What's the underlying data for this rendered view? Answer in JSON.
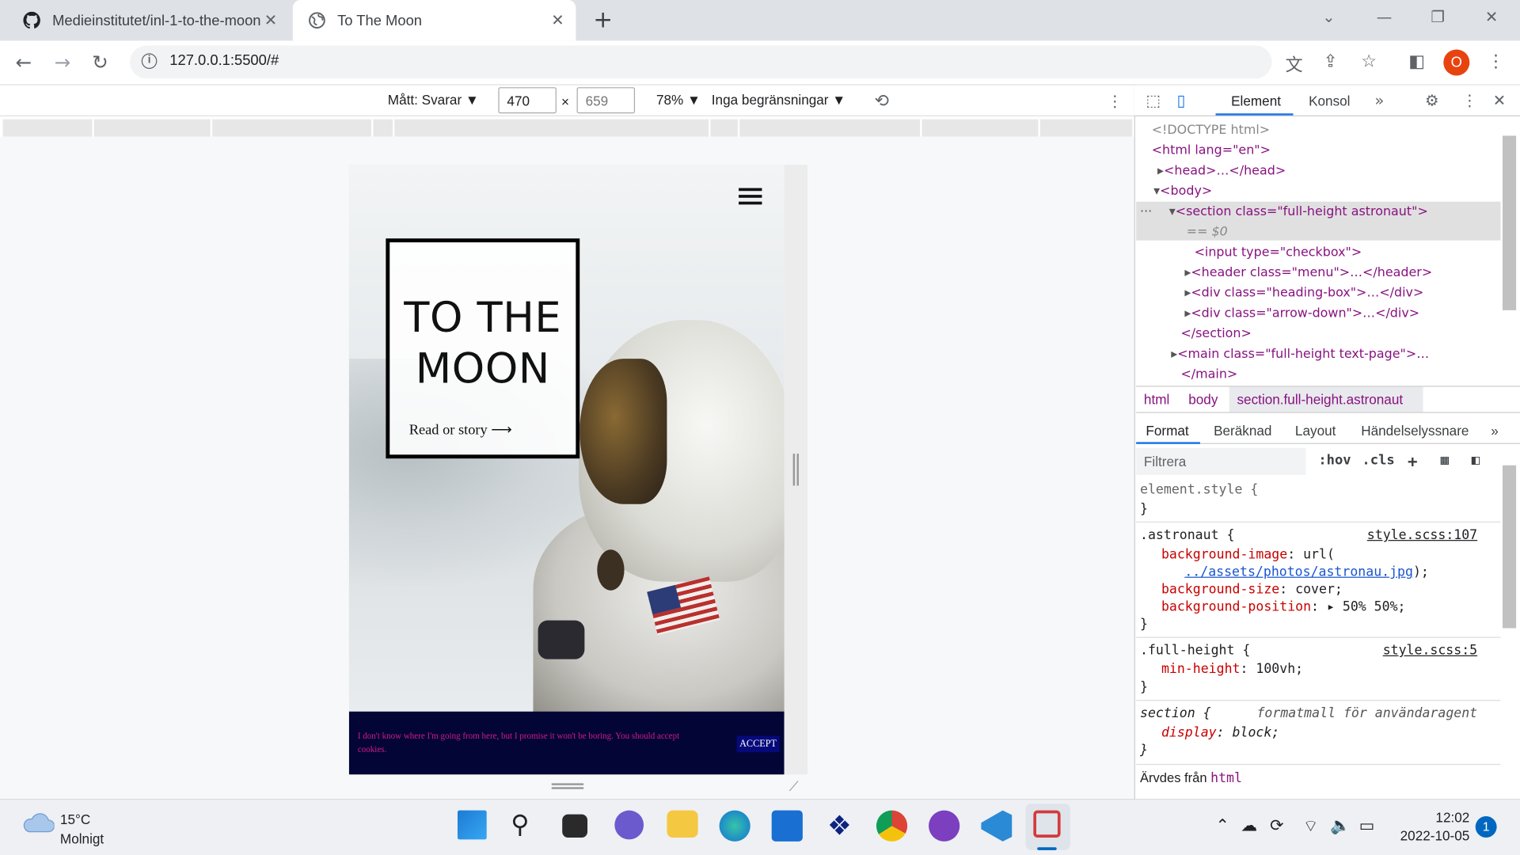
{
  "browser": {
    "tabs": [
      {
        "title": "Medieinstitutet/inl-1-to-the-moon",
        "icon": "github-icon"
      },
      {
        "title": "To The Moon",
        "icon": "globe-icon"
      }
    ],
    "url": "127.0.0.1:5500/#"
  },
  "device_toolbar": {
    "device_label": "Mått: Svarar ▼",
    "width": "470",
    "height": "659",
    "times": "×",
    "zoom": "78% ▼",
    "throttle": "Inga begränsningar ▼"
  },
  "page": {
    "heading": "TO THE MOON",
    "heading_line1": "TO THE",
    "heading_line2": "MOON",
    "link": "Read or story ⟶",
    "cookie_text": "I don't know where I'm going from here, but I promise it won't be boring. You should accept cookies.",
    "cookie_button": "ACCEPT"
  },
  "devtools": {
    "tabs": [
      "Element",
      "Konsol"
    ],
    "dom_lines": [
      "<!DOCTYPE html>",
      "<html lang=\"en\">",
      "<head>…</head>",
      "<body>",
      "<section class=\"full-height astronaut\">",
      "== $0",
      "<input type=\"checkbox\">",
      "<header class=\"menu\">…</header>",
      "<div class=\"heading-box\">…</div>",
      "<div class=\"arrow-down\">…</div>",
      "</section>",
      "<main class=\"full-height text-page\">…",
      "</main>"
    ],
    "breadcrumbs": [
      "html",
      "body",
      "section.full-height.astronaut"
    ],
    "subtabs": [
      "Format",
      "Beräknad",
      "Layout",
      "Händelselyssnare"
    ],
    "filter_placeholder": "Filtrera",
    "hov": ":hov",
    "cls": ".cls",
    "styles": {
      "element_style": "element.style {",
      "close": "}",
      "astronaut_selector": ".astronaut {",
      "astronaut_src": "style.scss:107",
      "bg_image_prop": "background-image",
      "bg_image_val": ": url(",
      "bg_image_url": "../assets/photos/astronau.jpg",
      "bg_image_end": ");",
      "bg_size_prop": "background-size",
      "bg_size_val": ": cover;",
      "bg_pos_prop": "background-position",
      "bg_pos_val": ": ▸ 50% 50%;",
      "fh_selector": ".full-height {",
      "fh_src": "style.scss:5",
      "minh_prop": "min-height",
      "minh_val": ": 100vh;",
      "section_selector": "section {",
      "ua_label": "formatmall för användaragent",
      "display_prop": "display",
      "display_val": ": block;",
      "inherited": "Ärvdes från",
      "inherited_tag": "html"
    }
  },
  "taskbar": {
    "temp": "15°C",
    "weather": "Molnigt",
    "time": "12:02",
    "date": "2022-10-05",
    "notifications": "1"
  },
  "colors": {
    "cookie_bg": "#030536",
    "cookie_text": "#d11a8a",
    "cookie_btn": "#06097a",
    "accent": "#1a73e8"
  }
}
